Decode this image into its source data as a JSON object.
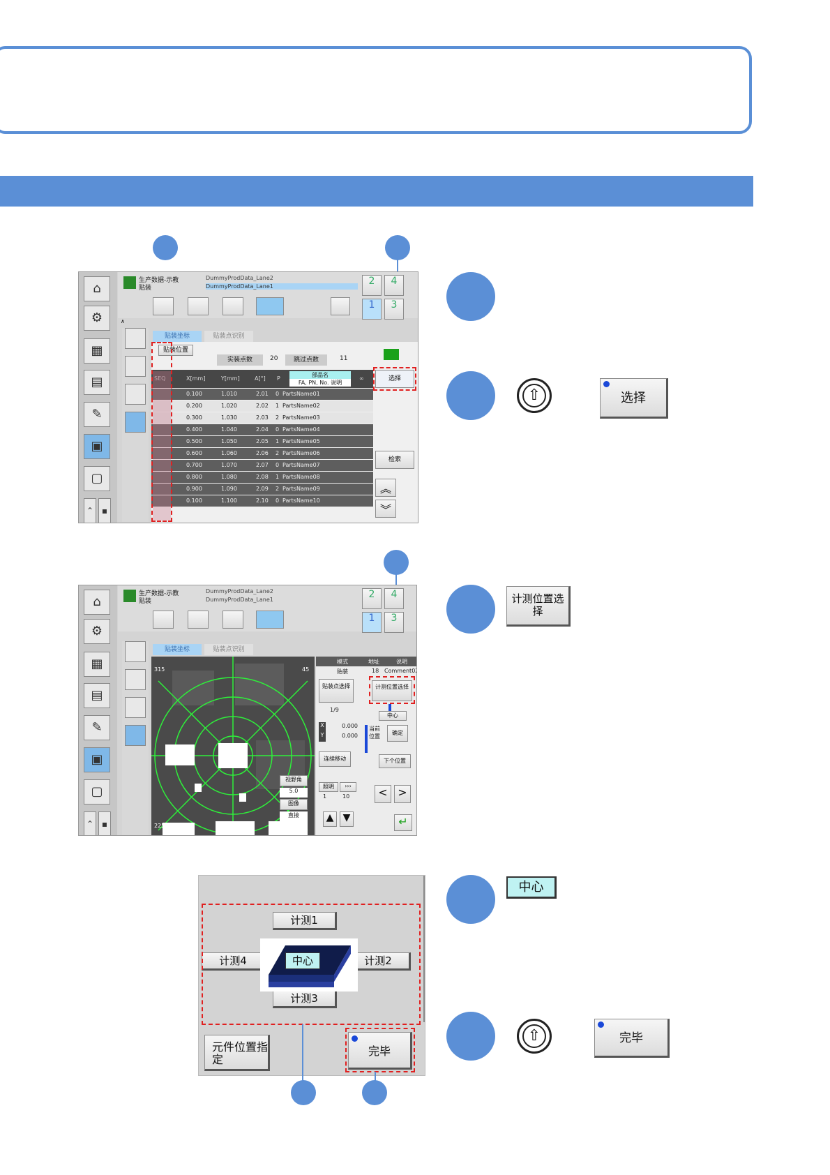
{
  "screen1": {
    "prod_title": "生产数据-示教",
    "prod_sub": "贴装",
    "file_a": "DummyProdData_Lane2",
    "file_b": "DummyProdData_Lane1",
    "tab_active": "贴装坐标",
    "tab_inactive": "贴装点识别",
    "position_btn": "贴装位置",
    "real_count_label": "实装点数",
    "real_count": "20",
    "skip_count_label": "跳过点数",
    "skip_count": "11",
    "col_headers": [
      "SEQ",
      "X[mm]",
      "Y[mm]",
      "A[°]",
      "P"
    ],
    "part_name_header": "部品名",
    "part_name_sub": "FA, PN, No. 说明",
    "select_btn": "选择",
    "search_btn": "检索",
    "rows": [
      {
        "x": "0.100",
        "y": "1.010",
        "a": "2.01",
        "p": "0",
        "name": "PartsName01"
      },
      {
        "x": "0.200",
        "y": "1.020",
        "a": "2.02",
        "p": "1",
        "name": "PartsName02"
      },
      {
        "x": "0.300",
        "y": "1.030",
        "a": "2.03",
        "p": "2",
        "name": "PartsName03"
      },
      {
        "x": "0.400",
        "y": "1.040",
        "a": "2.04",
        "p": "0",
        "name": "PartsName04"
      },
      {
        "x": "0.500",
        "y": "1.050",
        "a": "2.05",
        "p": "1",
        "name": "PartsName05"
      },
      {
        "x": "0.600",
        "y": "1.060",
        "a": "2.06",
        "p": "2",
        "name": "PartsName06"
      },
      {
        "x": "0.700",
        "y": "1.070",
        "a": "2.07",
        "p": "0",
        "name": "PartsName07"
      },
      {
        "x": "0.800",
        "y": "1.080",
        "a": "2.08",
        "p": "1",
        "name": "PartsName08"
      },
      {
        "x": "0.900",
        "y": "1.090",
        "a": "2.09",
        "p": "2",
        "name": "PartsName09"
      },
      {
        "x": "0.100",
        "y": "1.100",
        "a": "2.10",
        "p": "0",
        "name": "PartsName10"
      }
    ],
    "stage_nums": [
      "2",
      "4",
      "1",
      "3"
    ]
  },
  "screen2": {
    "prod_title": "生产数据-示教",
    "prod_sub": "贴装",
    "file_a": "DummyProdData_Lane2",
    "file_b": "DummyProdData_Lane1",
    "tab_active": "贴装坐标",
    "tab_inactive": "贴装点识别",
    "info_headers": [
      "模式",
      "地址",
      "说明"
    ],
    "info_values": [
      "贴装",
      "18",
      "Comment02"
    ],
    "point_select": "贴装点选择",
    "point_count": "1/9",
    "measure_select": "计测位置选择",
    "center": "中心",
    "current_pos": "当前位置",
    "confirm": "确定",
    "next_pos": "下个位置",
    "x_label": "X",
    "y_label": "Y",
    "x_val": "0.000",
    "y_val": "0.000",
    "continuous_move": "连续移动",
    "view_angle": "视野角",
    "view_val": "5.0",
    "image": "图像",
    "direct": "直接",
    "light": "照明",
    "light_vals": [
      "1",
      "10"
    ],
    "angle_315": "315",
    "angle_45": "45",
    "angle_225": "225",
    "stage_nums": [
      "2",
      "4",
      "1",
      "3"
    ]
  },
  "screen3": {
    "measure1": "计测1",
    "measure2": "计测2",
    "measure3": "计测3",
    "measure4": "计测4",
    "center": "中心",
    "component_pos": "元件位置指定",
    "done": "完毕"
  },
  "steps": {
    "select_btn": "选择",
    "measure_select_btn": "计测位置选择",
    "center_btn": "中心",
    "done_btn": "完毕"
  }
}
